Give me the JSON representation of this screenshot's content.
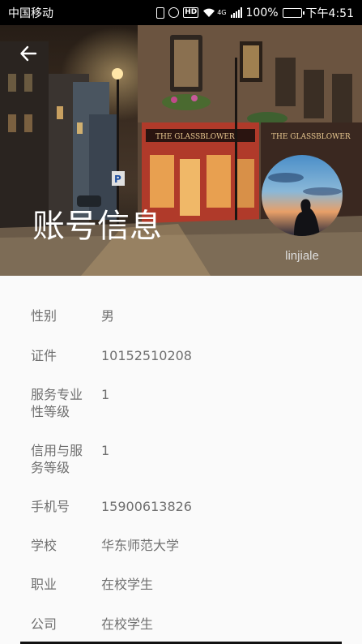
{
  "status_bar": {
    "carrier": "中国移动",
    "battery_percent": "100%",
    "time": "下午4:51",
    "network": "4G",
    "icons": [
      "vibrate-icon",
      "alarm-icon",
      "hd-icon",
      "wifi-icon",
      "signal-icon",
      "battery-icon"
    ]
  },
  "header": {
    "title": "账号信息",
    "username": "linjiale",
    "back_icon": "arrow-left-icon"
  },
  "info": [
    {
      "label": "性别",
      "value": "男"
    },
    {
      "label": "证件",
      "value": "10152510208"
    },
    {
      "label": "服务专业性等级",
      "value": "1"
    },
    {
      "label": "信用与服务等级",
      "value": "1"
    },
    {
      "label": "手机号",
      "value": "15900613826"
    },
    {
      "label": "学校",
      "value": "华东师范大学"
    },
    {
      "label": "职业",
      "value": "在校学生"
    },
    {
      "label": "公司",
      "value": "在校学生"
    }
  ]
}
